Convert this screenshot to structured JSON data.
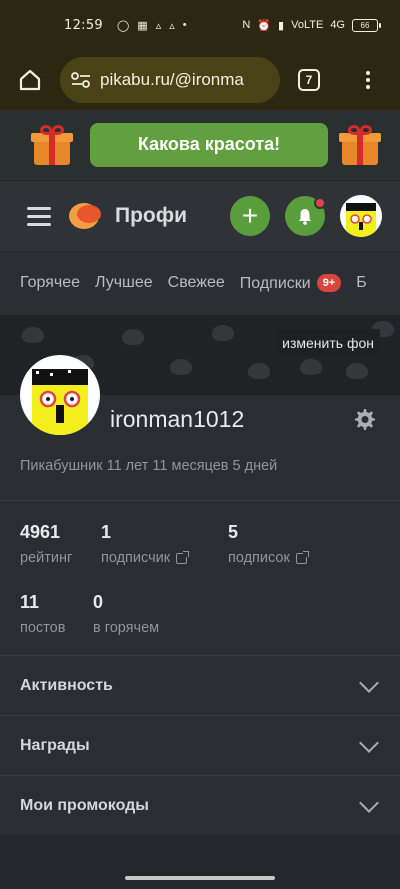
{
  "status_bar": {
    "time": "12:59",
    "network": "4G",
    "battery": "66"
  },
  "browser": {
    "url": "pikabu.ru/@ironma",
    "tab_count": "7"
  },
  "promo": {
    "button_label": "Какова красота!"
  },
  "header": {
    "brand": "Профи"
  },
  "nav": {
    "tabs": [
      "Горячее",
      "Лучшее",
      "Свежее",
      "Подписки",
      "Б"
    ],
    "subscriptions_badge": "9+"
  },
  "cover": {
    "change_background_label": "изменить фон"
  },
  "profile": {
    "username": "ironman1012",
    "member_since": "Пикабушник 11 лет 11 месяцев 5 дней",
    "stats": {
      "rating_value": "4961",
      "rating_label": "рейтинг",
      "followers_value": "1",
      "followers_label": "подписчик",
      "subscriptions_value": "5",
      "subscriptions_label": "подписок",
      "posts_value": "11",
      "posts_label": "постов",
      "hot_value": "0",
      "hot_label": "в горячем"
    }
  },
  "sections": {
    "activity": "Активность",
    "awards": "Награды",
    "promocodes": "Мои промокоды"
  }
}
